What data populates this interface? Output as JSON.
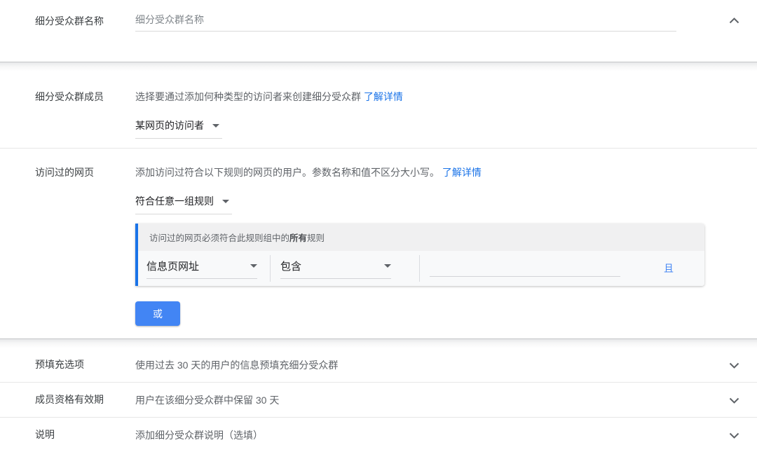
{
  "colors": {
    "accent_blue": "#4285f4",
    "link_blue": "#1a73e8",
    "rule_border_blue": "#1a73e8",
    "label_text": "#3c4043",
    "secondary_text": "#5f6368"
  },
  "icons": {
    "collapse": "chevron-up-icon",
    "expand": "chevron-down-icon",
    "dropdown": "caret-down-icon"
  },
  "name_section": {
    "label": "细分受众群名称",
    "input_value": "",
    "input_placeholder": "细分受众群名称"
  },
  "members_section": {
    "label": "细分受众群成员",
    "description": "选择要通过添加何种类型的访问者来创建细分受众群",
    "learn_more": "了解详情",
    "visitor_type_value": "某网页的访问者"
  },
  "visited_section": {
    "label": "访问过的网页",
    "description": "添加访问过符合以下规则的网页的用户。参数名称和值不区分大小写。",
    "learn_more": "了解详情",
    "match_type_value": "符合任意一组规则",
    "rule_group": {
      "header_prefix": "访问过的网页必须符合此规则组中的",
      "header_bold": "所有",
      "header_suffix": "规则",
      "field_value": "信息页网址",
      "operator_value": "包含",
      "value_input": "",
      "and_link": "且"
    },
    "or_button": "或"
  },
  "collapsed_rows": [
    {
      "label": "预填充选项",
      "summary": "使用过去 30 天的用户的信息预填充细分受众群"
    },
    {
      "label": "成员资格有效期",
      "summary": "用户在该细分受众群中保留 30 天"
    },
    {
      "label": "说明",
      "summary": "添加细分受众群说明（选填）"
    }
  ]
}
